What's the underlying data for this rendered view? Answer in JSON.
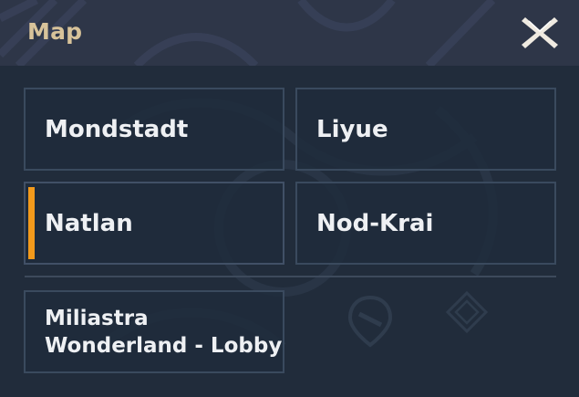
{
  "header": {
    "title": "Map"
  },
  "regions": [
    {
      "label": "Mondstadt",
      "selected": false
    },
    {
      "label": "Liyue",
      "selected": false
    },
    {
      "label": "Natlan",
      "selected": true
    },
    {
      "label": "Nod-Krai",
      "selected": false
    }
  ],
  "extra": {
    "line1": "Miliastra",
    "line2": "Wonderland - Lobby"
  },
  "colors": {
    "accent": "#f39a1b",
    "title": "#d8c39a",
    "header_bg": "#2e3648",
    "panel_bg": "#212c3b"
  },
  "icons": {
    "close": "close-x-icon"
  }
}
